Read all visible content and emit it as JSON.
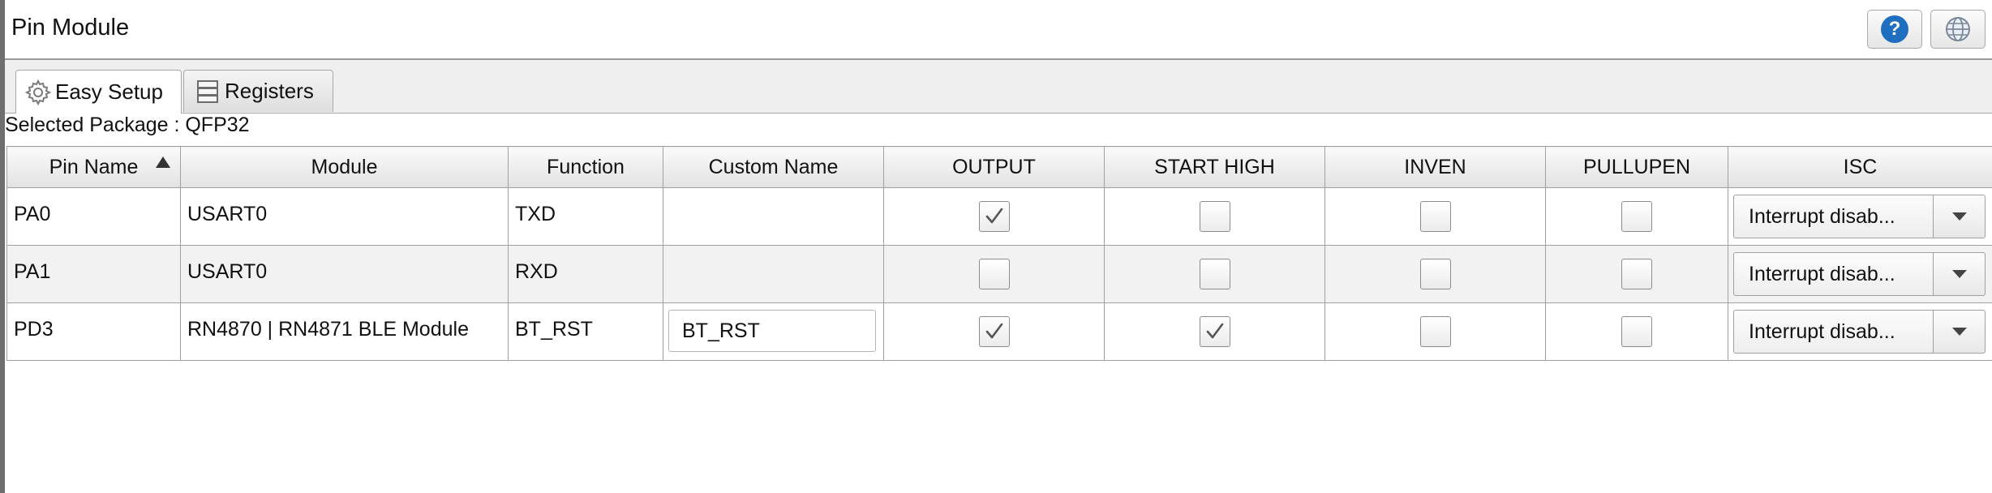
{
  "window": {
    "title": "Pin Module"
  },
  "toolbar": {
    "help_icon": "help-icon",
    "globe_icon": "globe-icon",
    "help_glyph": "?"
  },
  "tabs": [
    {
      "label": "Easy Setup",
      "icon": "gear-icon",
      "active": true
    },
    {
      "label": "Registers",
      "icon": "registers-icon",
      "active": false
    }
  ],
  "package": {
    "text": "Selected Package : QFP32"
  },
  "table": {
    "columns": [
      "Pin Name",
      "Module",
      "Function",
      "Custom Name",
      "OUTPUT",
      "START HIGH",
      "INVEN",
      "PULLUPEN",
      "ISC"
    ],
    "sort": {
      "column": "Pin Name",
      "direction": "ascending"
    },
    "rows": [
      {
        "pin": "PA0",
        "module": "USART0",
        "function": "TXD",
        "custom_name": "",
        "output": true,
        "start_high": false,
        "inven": false,
        "pullupen": false,
        "isc": "Interrupt disab..."
      },
      {
        "pin": "PA1",
        "module": "USART0",
        "function": "RXD",
        "custom_name": "",
        "output": false,
        "start_high": false,
        "inven": false,
        "pullupen": false,
        "isc": "Interrupt disab..."
      },
      {
        "pin": "PD3",
        "module": "RN4870 | RN4871 BLE Module",
        "function": "BT_RST",
        "custom_name": "BT_RST",
        "output": true,
        "start_high": true,
        "inven": false,
        "pullupen": false,
        "isc": "Interrupt disab..."
      }
    ]
  },
  "colors": {
    "help_blue": "#1f6fc1",
    "grid_border": "#a0a0a0",
    "alt_row": "#f2f2f2"
  }
}
